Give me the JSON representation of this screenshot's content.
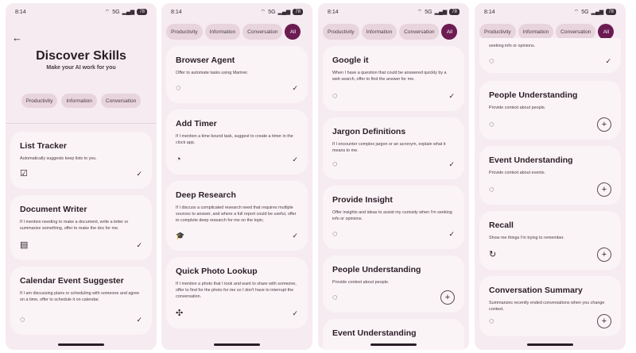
{
  "status": {
    "time": "8:14",
    "network": "5G",
    "battery": "78"
  },
  "filters": {
    "productivity": "Productivity",
    "information": "Information",
    "conversation": "Conversation",
    "all": "All"
  },
  "screen1": {
    "title": "Discover Skills",
    "subtitle": "Make your AI work for you",
    "cards": [
      {
        "title": "List Tracker",
        "desc": "Automatically suggests keep lists to you.",
        "icon": "checklist-icon"
      },
      {
        "title": "Document Writer",
        "desc": "If I mention needing to make a document, write a letter or summarize something, offer to make the doc for me.",
        "icon": "document-icon"
      },
      {
        "title": "Calendar Event Suggester",
        "desc": "If I am discussing plans or scheduling with someone and agree on a time, offer to schedule it on calendar.",
        "icon": "assistant-icon"
      }
    ]
  },
  "screen2": {
    "cards": [
      {
        "title": "Browser Agent",
        "desc": "Offer to automate tasks using Mariner.",
        "icon": "assistant-icon"
      },
      {
        "title": "Add Timer",
        "desc": "If I mention a time bound task, suggest to create a timer in the clock app.",
        "icon": "timer-icon"
      },
      {
        "title": "Deep Research",
        "desc": "If I discuss a complicated research need that requires multiple sources to answer, and where a full report could be useful, offer to complete deep research for me on the topic.",
        "icon": "graduation-cap-icon"
      },
      {
        "title": "Quick Photo Lookup",
        "desc": "If I mention a photo that I took and want to share with someone, offer to find for the photo for me so I don't have to interrupt the conversation.",
        "icon": "pinwheel-icon"
      }
    ]
  },
  "screen3": {
    "cards": [
      {
        "title": "Google it",
        "desc": "When I have a question that could be answered quickly by a web search, offer to find the answer for me.",
        "icon": "assistant-icon"
      },
      {
        "title": "Jargon Definitions",
        "desc": "If I encounter complex jargon or an acronym, explain what it means to me.",
        "icon": "assistant-icon"
      },
      {
        "title": "Provide Insight",
        "desc": "Offer insights and ideas to assist my curiosity when I'm seeking info or opinions.",
        "icon": "assistant-icon"
      },
      {
        "title": "People Understanding",
        "desc": "Provide context about people.",
        "icon": "assistant-icon"
      },
      {
        "title": "Event Understanding",
        "desc": "",
        "icon": ""
      }
    ]
  },
  "screen4": {
    "top_text": "seeking info or opinions.",
    "cards": [
      {
        "title": "People Understanding",
        "desc": "Provide context about people.",
        "icon": "assistant-icon"
      },
      {
        "title": "Event Understanding",
        "desc": "Provide context about events.",
        "icon": "assistant-icon"
      },
      {
        "title": "Recall",
        "desc": "Show me things I'm trying to remember.",
        "icon": "refresh-icon"
      },
      {
        "title": "Conversation Summary",
        "desc": "Summarizes recently ended conversations when you change context.",
        "icon": "assistant-icon"
      }
    ]
  },
  "glyphs": {
    "check": "✓",
    "plus": "+",
    "back": "←",
    "signal": "▂▄▆",
    "wifi": "⌔",
    "assistant": "◌",
    "checklist": "☑",
    "document": "▤",
    "timer": "◔",
    "cap": "🎓",
    "pinwheel": "✣",
    "refresh": "↻"
  }
}
